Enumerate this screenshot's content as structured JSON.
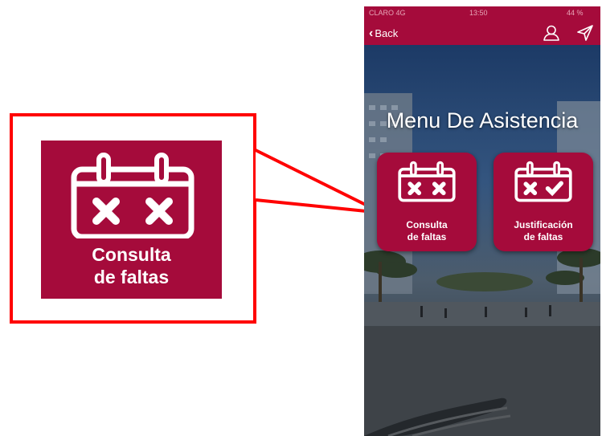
{
  "callout": {
    "label_line1": "Consulta",
    "label_line2": "de faltas",
    "icon": "calendar-x-icon",
    "frame_color": "#ff0000",
    "tile_color": "#a50b3b"
  },
  "phone": {
    "status_bar": {
      "carrier": "CLARO 4G",
      "time": "13:50",
      "battery": "44 %"
    },
    "nav_bar": {
      "back_label": "Back",
      "icons": [
        "chevron-left-icon",
        "user-icon",
        "send-icon"
      ],
      "color": "#a50b3b"
    },
    "title": "Menu De Asistencia",
    "tiles": [
      {
        "line1": "Consulta",
        "line2": "de faltas",
        "icon": "calendar-x-icon"
      },
      {
        "line1": "Justificación",
        "line2": "de faltas",
        "icon": "calendar-check-icon"
      }
    ]
  }
}
